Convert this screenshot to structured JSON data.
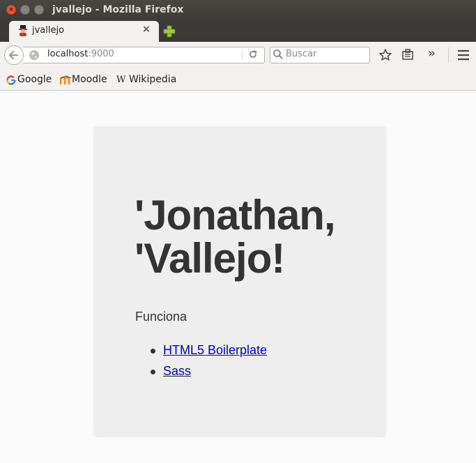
{
  "window": {
    "title": "jvallejo - Mozilla Firefox"
  },
  "tab": {
    "label": "jvallejo",
    "close": "×"
  },
  "navbar": {
    "url_host": "localhost",
    "url_port": ":9000",
    "search_placeholder": "Buscar",
    "overflow": "»"
  },
  "bookmarks": [
    {
      "label": "Google"
    },
    {
      "label": "Moodle"
    },
    {
      "label": "Wikipedia"
    }
  ],
  "page": {
    "heading_line1": "'Jonathan,",
    "heading_line2": "'Vallejo!",
    "paragraph": "Funciona",
    "links": [
      {
        "label": "HTML5 Boilerplate"
      },
      {
        "label": "Sass"
      }
    ]
  },
  "colors": {
    "link": "#0000ee",
    "card_bg": "#eeeeee",
    "close_button": "#e9552b"
  }
}
